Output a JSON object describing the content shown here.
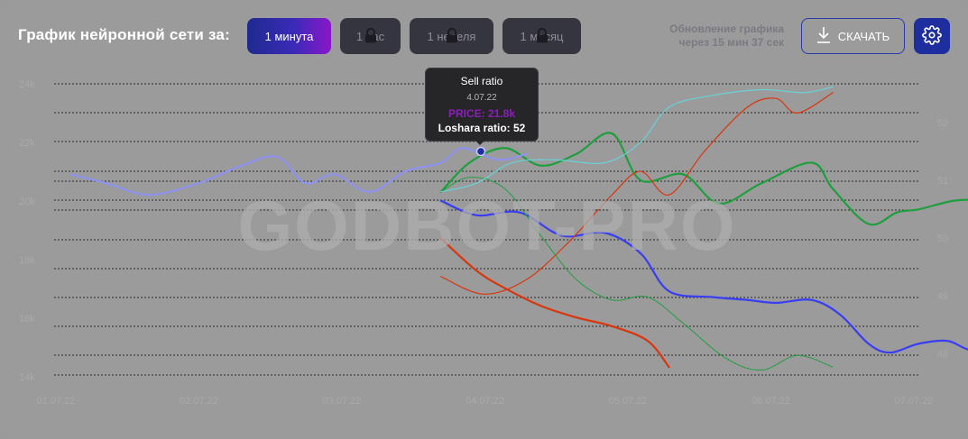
{
  "toolbar": {
    "label": "График нейронной сети за:",
    "periods": [
      {
        "label": "1 минута",
        "active": true,
        "locked": false
      },
      {
        "label": "1 час",
        "active": false,
        "locked": true
      },
      {
        "label": "1 неделя",
        "active": false,
        "locked": true
      },
      {
        "label": "1 месяц",
        "active": false,
        "locked": true
      }
    ],
    "update_line1": "Обновление графика",
    "update_line2": "через 15 мин 37 сек",
    "download_label": "СКАЧАТЬ"
  },
  "watermark": "GODBOT-PRO",
  "tooltip": {
    "title": "Sell ratio",
    "date": "4.07.22",
    "price": "PRICE: 21.8k",
    "ratio": "Loshara ratio: 52"
  },
  "colors": {
    "active_button": "#1e2a8f",
    "accent": "#1e2e9e",
    "green": "#1f9e3e",
    "blue": "#3a3ef2",
    "red": "#d8360e",
    "cyan": "#6ad0d8",
    "lavender": "#8f93f0",
    "purple": "#8a1fb8"
  },
  "chart_data": {
    "type": "line",
    "x_ticks": [
      "01.07.22",
      "02.07.22",
      "03.07.22",
      "04.07.22",
      "05.07.22",
      "06.07.22",
      "07.07.22"
    ],
    "y_left_ticks": [
      "24k",
      "22k",
      "20k",
      "18k",
      "16k",
      "14k"
    ],
    "y_right_ticks": [
      "52",
      "51",
      "50",
      "49",
      "48"
    ],
    "series": [
      {
        "color": "#1f9e3e",
        "style": "solid",
        "x": [
          2.6,
          2.8,
          3.05,
          3.3,
          3.55,
          3.8,
          4.0,
          4.3,
          4.55,
          4.85,
          5.2,
          5.35,
          5.6,
          5.8,
          5.95,
          6.2,
          6.4,
          6.55
        ],
        "y": [
          20.3,
          21.3,
          21.8,
          21.2,
          21.6,
          22.3,
          20.7,
          20.9,
          19.9,
          20.6,
          21.3,
          20.4,
          19.2,
          19.6,
          19.7,
          20.0,
          20.0,
          19.8
        ]
      },
      {
        "color": "#3a3ef2",
        "style": "solid",
        "x": [
          2.6,
          2.85,
          3.15,
          3.45,
          3.75,
          4.0,
          4.2,
          4.5,
          4.75,
          4.95,
          5.2,
          5.4,
          5.6,
          5.75,
          5.95,
          6.15,
          6.3,
          6.55
        ],
        "y": [
          20.0,
          19.5,
          19.6,
          18.8,
          18.9,
          18.2,
          16.9,
          16.7,
          16.6,
          16.5,
          16.6,
          16.1,
          15.1,
          14.8,
          15.1,
          15.2,
          14.9,
          14.6
        ]
      },
      {
        "color": "#d8360e",
        "style": "solid",
        "x": [
          2.6,
          2.85,
          3.05,
          3.3,
          3.55,
          3.8,
          4.05,
          4.2
        ],
        "y": [
          18.7,
          17.6,
          17.0,
          16.4,
          16.0,
          15.7,
          15.2,
          14.3
        ]
      },
      {
        "color": "#d8360e",
        "style": "thin",
        "x": [
          2.6,
          2.9,
          3.2,
          3.5,
          3.8,
          4.0,
          4.2,
          4.45,
          4.75,
          4.95,
          5.1,
          5.35
        ],
        "y": [
          17.4,
          16.8,
          17.3,
          18.6,
          20.2,
          21.0,
          20.2,
          21.7,
          23.2,
          23.5,
          23.0,
          23.7
        ]
      },
      {
        "color": "#1f9e3e",
        "style": "dotted",
        "x": [
          2.6,
          2.8,
          3.05,
          3.3,
          3.55,
          3.8,
          4.05,
          4.3,
          4.6,
          4.85,
          5.1,
          5.35
        ],
        "y": [
          20.3,
          20.8,
          20.4,
          18.8,
          17.3,
          16.6,
          16.7,
          15.8,
          14.6,
          14.2,
          14.7,
          14.3
        ]
      },
      {
        "color": "#6ad0d8",
        "style": "thin",
        "x": [
          2.6,
          2.85,
          3.1,
          3.4,
          3.75,
          4.0,
          4.2,
          4.5,
          4.85,
          5.15,
          5.35
        ],
        "y": [
          20.3,
          20.6,
          21.3,
          21.4,
          21.3,
          22.0,
          23.2,
          23.6,
          23.8,
          23.7,
          23.9
        ]
      },
      {
        "color": "#8f93f0",
        "style": "solid",
        "x": [
          0.0,
          0.25,
          0.55,
          0.9,
          1.2,
          1.45,
          1.65,
          1.85,
          2.1,
          2.35,
          2.6,
          2.75,
          3.0,
          3.2
        ],
        "y": [
          20.9,
          20.6,
          20.2,
          20.6,
          21.2,
          21.5,
          20.6,
          20.9,
          20.3,
          21.0,
          21.3,
          21.8,
          21.4,
          21.6
        ]
      }
    ],
    "highlight_point": {
      "x": 3.1,
      "y": 21.8
    }
  }
}
